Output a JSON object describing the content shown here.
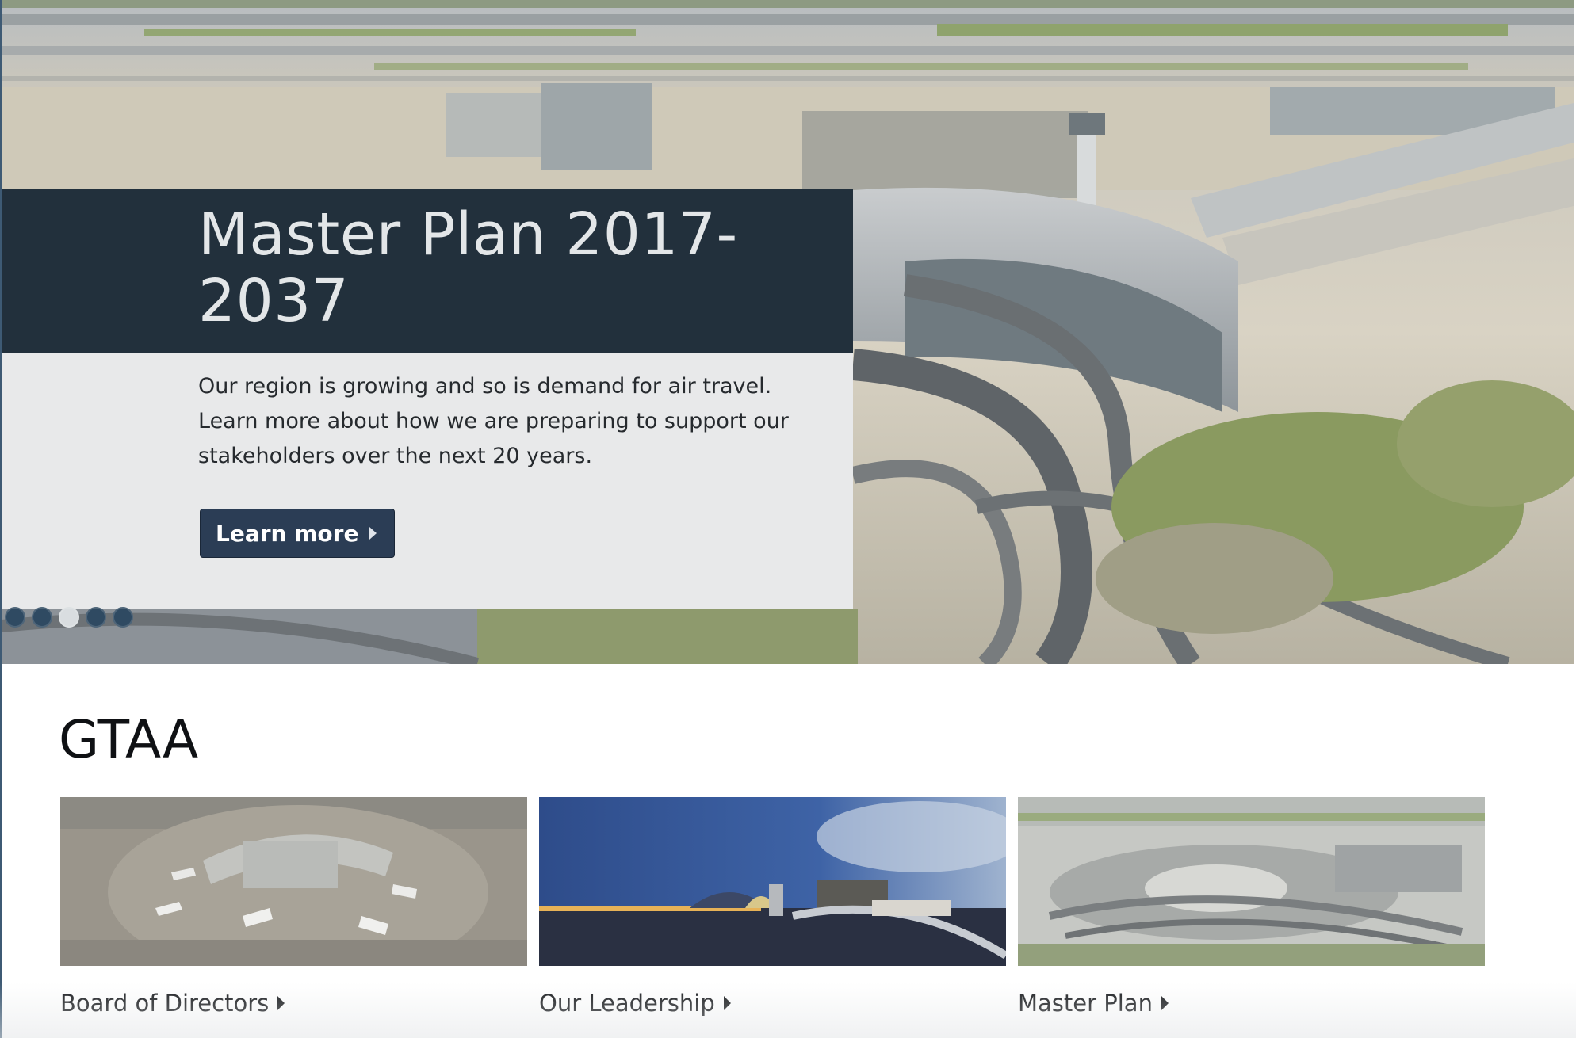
{
  "hero": {
    "title": "Master Plan 2017-2037",
    "description": "Our region is growing and so is demand for air travel. Learn more about how we are preparing to support our stakeholders over the next 20 years.",
    "cta_label": "Learn more",
    "slide_count": 5,
    "active_slide": 2
  },
  "section": {
    "title": "GTAA",
    "cards": [
      {
        "label": "Board of Directors"
      },
      {
        "label": "Our Leadership"
      },
      {
        "label": "Master Plan"
      }
    ]
  },
  "colors": {
    "title_panel": "#22303c",
    "body_panel": "#e8e9ea",
    "button": "#2b3d55",
    "dot": "#2f4a62"
  }
}
